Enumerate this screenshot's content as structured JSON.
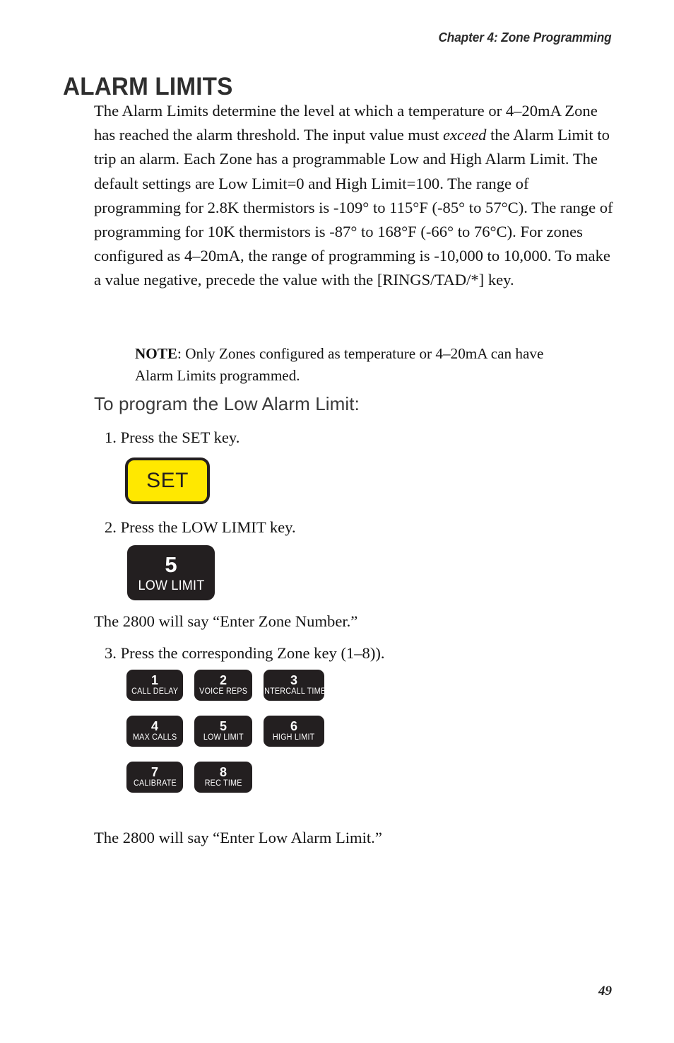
{
  "header": {
    "running_head": "Chapter 4: Zone Programming"
  },
  "title": "ALARM LIMITS",
  "body": {
    "paragraph": "The Alarm Limits determine the level at which a temperature or 4–20mA Zone has reached the alarm threshold. The input value must ",
    "paragraph_emphasis": "exceed",
    "paragraph_cont": " the Alarm Limit to trip an alarm. Each Zone has a programmable Low and High Alarm Limit. The default settings are Low Limit=0 and High Limit=100. The range of programming for 2.8K thermistors is -109° to 115°F (-85° to 57°C). The range of programming for 10K thermistors is -87° to 168°F (-66° to 76°C). For zones configured as 4–20mA, the range of programming is -10,000 to 10,000. To make a value negative, precede the value with the [RINGS/TAD/*] key."
  },
  "note": {
    "label": "NOTE",
    "text": ": Only Zones configured as temperature or 4–20mA can have Alarm Limits programmed."
  },
  "subheading": "To program the Low Alarm Limit:",
  "steps": {
    "step1": "1. Press the SET key.",
    "step2": "2. Press the LOW LIMIT key.",
    "step3": "3. Press the corresponding Zone key (1–8))."
  },
  "narration": {
    "after_step2": "The 2800 will say “Enter Zone Number.”",
    "after_step3": "The 2800 will say “Enter Low Alarm Limit.”"
  },
  "set_key": {
    "label": "SET",
    "background": "#ffe800",
    "border": "#231f20",
    "text_color": "#231f20"
  },
  "low_limit_key": {
    "number": "5",
    "label": "LOW LIMIT",
    "background": "#231f20",
    "text_color": "#ffffff"
  },
  "keypad": {
    "background": "#231f20",
    "text_color": "#ffffff",
    "keys": [
      {
        "number": "1",
        "label": "CALL DELAY"
      },
      {
        "number": "2",
        "label": "VOICE REPS"
      },
      {
        "number": "3",
        "label": "INTERCALL TIME"
      },
      {
        "number": "4",
        "label": "MAX CALLS"
      },
      {
        "number": "5",
        "label": "LOW LIMIT"
      },
      {
        "number": "6",
        "label": "HIGH LIMIT"
      },
      {
        "number": "7",
        "label": "CALIBRATE"
      },
      {
        "number": "8",
        "label": "REC TIME"
      }
    ]
  },
  "page_number": "49"
}
